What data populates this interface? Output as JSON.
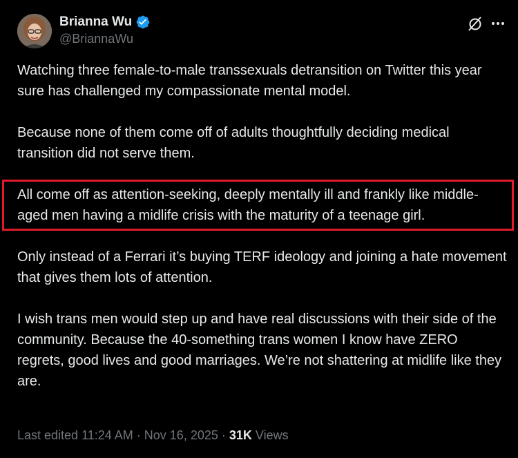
{
  "author": {
    "display_name": "Brianna Wu",
    "handle": "@BriannaWu",
    "verified_badge_color": "#1d9bf0"
  },
  "actions": {
    "grok_icon": "grok-icon",
    "more_icon": "more-icon"
  },
  "tweet": {
    "paragraphs": [
      "Watching three female-to-male transsexuals detransition on Twitter this year sure has challenged my compassionate mental model.",
      "Because none of them come off of adults thoughtfully deciding medical transition did not serve them.",
      "All come off as attention-seeking, deeply mentally ill and frankly like middle-aged men having a midlife crisis with the maturity of a teenage girl.",
      "Only instead of a Ferrari it’s buying TERF ideology and joining a hate movement that gives them lots of attention.",
      "I wish trans men would step up and have real discussions with their side of the community. Because the 40-something trans women I know have ZERO regrets, good lives and good marriages. We’re not shattering at midlife like they are."
    ],
    "highlight_color": "#e21b2c"
  },
  "meta": {
    "edited_label": "Last edited 11:24 AM · Nov 16, 2025 · ",
    "views_count": "31K",
    "views_label": " Views"
  }
}
